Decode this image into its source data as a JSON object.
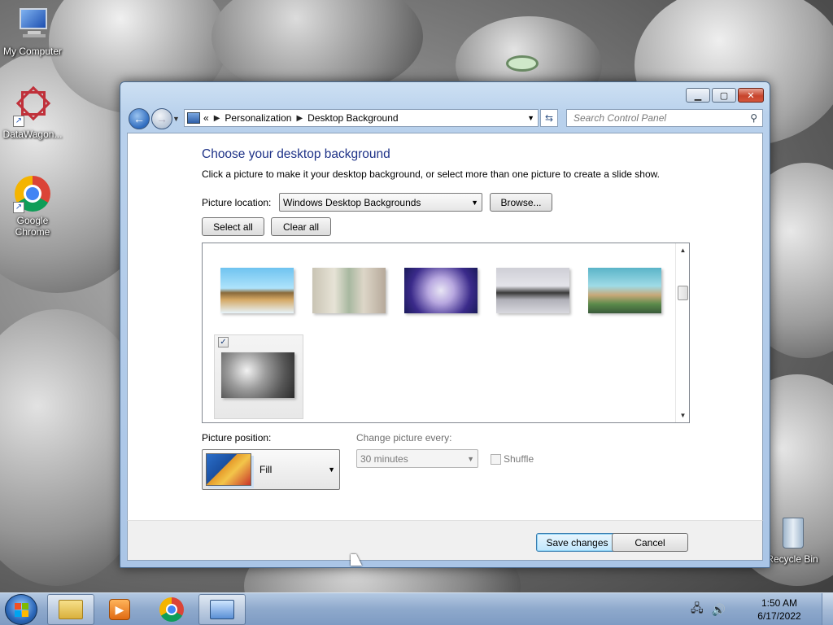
{
  "desktop": {
    "icons": [
      {
        "label": "My Computer"
      },
      {
        "label": "DataWagon..."
      },
      {
        "label": "Google Chrome"
      },
      {
        "label": "Recycle Bin"
      }
    ]
  },
  "window": {
    "address": {
      "overflow": "«",
      "crumbs": [
        "Personalization",
        "Desktop Background"
      ]
    },
    "search_placeholder": "Search Control Panel",
    "heading": "Choose your desktop background",
    "subtext": "Click a picture to make it your desktop background, or select more than one picture to create a slide show.",
    "picture_location_label": "Picture location:",
    "picture_location_value": "Windows Desktop Backgrounds",
    "browse_label": "Browse...",
    "select_all_label": "Select all",
    "clear_all_label": "Clear all",
    "thumbnails": [
      {
        "name": "Floating island",
        "selected": false
      },
      {
        "name": "Paper characters",
        "selected": false
      },
      {
        "name": "Purple creatures",
        "selected": false
      },
      {
        "name": "Silhouette scene",
        "selected": false
      },
      {
        "name": "Coastal town",
        "selected": false
      },
      {
        "name": "Grey figures",
        "selected": true
      }
    ],
    "picture_position_label": "Picture position:",
    "picture_position_value": "Fill",
    "change_every_label": "Change picture every:",
    "change_every_value": "30 minutes",
    "shuffle_label": "Shuffle",
    "save_label": "Save changes",
    "cancel_label": "Cancel"
  },
  "taskbar": {
    "time": "1:50 AM",
    "date": "6/17/2022"
  },
  "colors": {
    "heading": "#1e3287",
    "taskbar": "#8ea9cc"
  }
}
